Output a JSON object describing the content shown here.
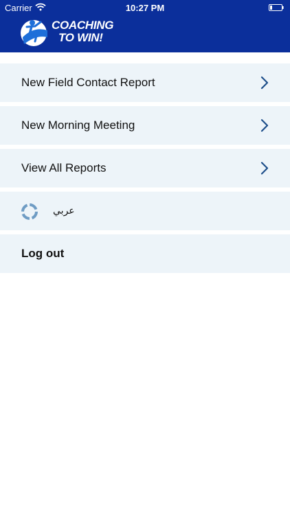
{
  "status_bar": {
    "carrier": "Carrier",
    "time": "10:27 PM",
    "wifi_icon": "wifi-icon",
    "battery_icon": "battery-low-icon"
  },
  "header": {
    "logo_line1": "COACHING",
    "logo_line2": "TO WIN!",
    "logo_icon": "runner-figure-icon",
    "background_color": "#0b2f9b"
  },
  "menu": {
    "items": [
      {
        "label": "New Field Contact Report",
        "icon": "chevron-right-icon"
      },
      {
        "label": "New Morning Meeting",
        "icon": "chevron-right-icon"
      },
      {
        "label": "View All Reports",
        "icon": "chevron-right-icon"
      }
    ],
    "language": {
      "label": "عربي",
      "icon": "language-circle-icon"
    },
    "logout": {
      "label": "Log out"
    },
    "row_color": "#edf4f9",
    "chevron_color": "#1d4e8a"
  }
}
